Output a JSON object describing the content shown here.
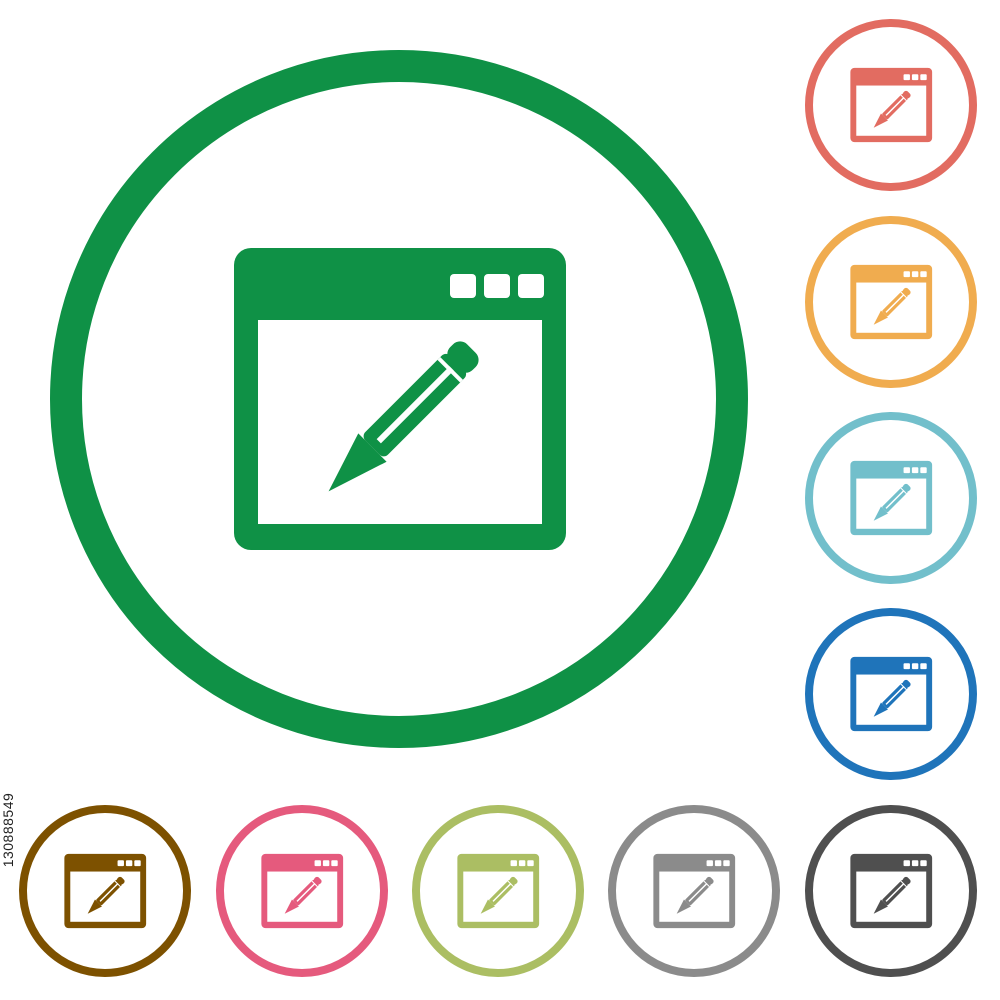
{
  "stock_id": "130888549",
  "icon": "application-edit-icon",
  "variants": [
    {
      "color": "#0f9146",
      "size": "large"
    },
    {
      "color": "#e26c61",
      "size": "small"
    },
    {
      "color": "#f0ac4f",
      "size": "small"
    },
    {
      "color": "#72bfcb",
      "size": "small"
    },
    {
      "color": "#1f74ba",
      "size": "small"
    },
    {
      "color": "#7d5100",
      "size": "small"
    },
    {
      "color": "#e55a7d",
      "size": "small"
    },
    {
      "color": "#abbe63",
      "size": "small"
    },
    {
      "color": "#8b8b8b",
      "size": "small"
    },
    {
      "color": "#4f4f4f",
      "size": "small"
    }
  ]
}
